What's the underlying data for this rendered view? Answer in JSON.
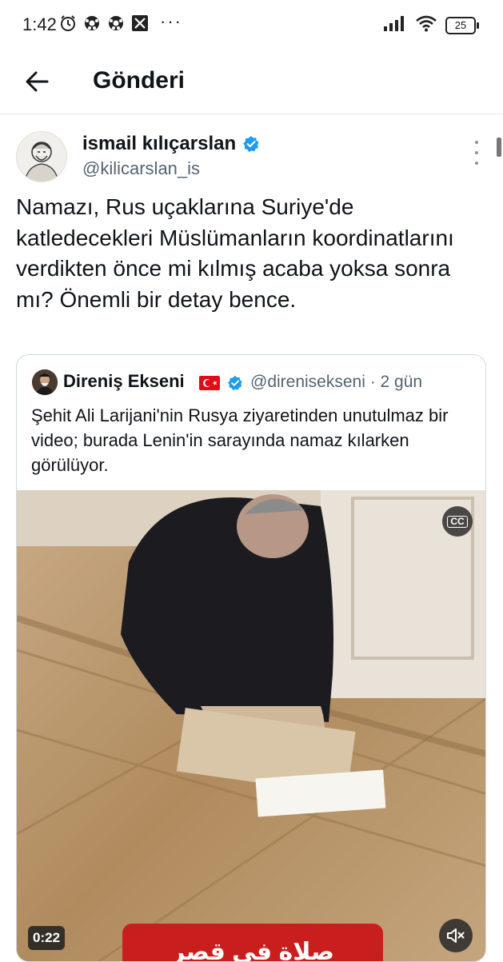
{
  "status_bar": {
    "time": "1:42",
    "more": "···",
    "battery": "25"
  },
  "header": {
    "title": "Gönderi"
  },
  "post": {
    "author_name": "ismail kılıçarslan",
    "author_handle": "@kilicarslan_is",
    "text": "Namazı, Rus uçaklarına Suriye'de katledecekleri Müslümanların koordinatlarını verdikten önce mi kılmış acaba yoksa sonra mı? Önemli bir detay bence."
  },
  "quote": {
    "author_name": "Direniş Ekseni",
    "handle_time": "@direnisekseni · 2 gün",
    "text": "Şehit Ali Larijani'nin Rusya ziyaretinden unutulmaz bir video; burada Lenin'in sarayında namaz kılarken görülüyor.",
    "video": {
      "cc_label": "CC",
      "duration": "0:22",
      "caption": "صلاة في قصر الكرملين"
    }
  },
  "colors": {
    "accent": "#1d9bf0",
    "text": "#0f1419",
    "secondary": "#536471",
    "flag": "#e30a17",
    "caption_bg": "#c81e1e"
  }
}
